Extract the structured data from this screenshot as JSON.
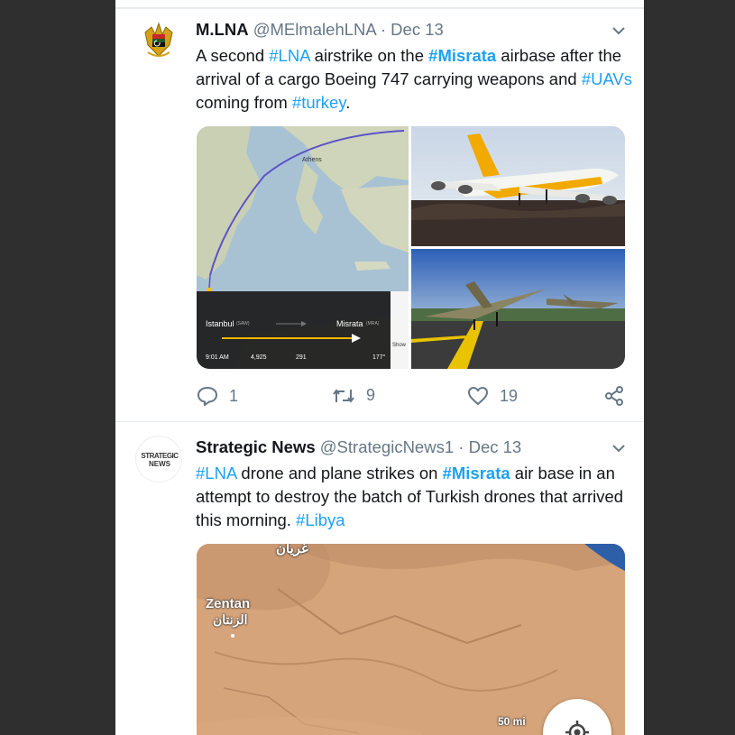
{
  "tweets": [
    {
      "name": "M.LNA",
      "handle": "@MElmalehLNA",
      "date": "Dec 13",
      "avatar_icon": "lna-emblem-icon",
      "text": [
        {
          "t": "A second ",
          "tag": false
        },
        {
          "t": "#LNA",
          "tag": true
        },
        {
          "t": " airstrike on the ",
          "tag": false
        },
        {
          "t": "#Misrata",
          "tag": true,
          "bold": true
        },
        {
          "t": " airbase after the arrival of a cargo Boeing 747 carrying weapons and ",
          "tag": false
        },
        {
          "t": "#UAVs",
          "tag": true
        },
        {
          "t": " coming from ",
          "tag": false
        },
        {
          "t": "#turkey",
          "tag": true
        },
        {
          "t": ".",
          "tag": false
        }
      ],
      "flight": {
        "from": "Istanbul",
        "from_code": "(SAW)",
        "to": "Misrata",
        "to_code": "(MRA)",
        "city_label": "Athens",
        "time": "9:01 AM",
        "alt": "4,925",
        "speed": "291",
        "heading": "177°",
        "side_label": "Show"
      },
      "replies": "1",
      "retweets": "9",
      "likes": "19"
    },
    {
      "name": "Strategic News",
      "handle": "@StrategicNews1",
      "date": "Dec 13",
      "avatar_text_1": "STRATEGIC",
      "avatar_text_2": "NEWS",
      "text": [
        {
          "t": "#LNA",
          "tag": true
        },
        {
          "t": " drone and plane strikes on ",
          "tag": false
        },
        {
          "t": "#Misrata",
          "tag": true,
          "bold": true
        },
        {
          "t": " air base in an attempt to destroy the batch of Turkish drones that arrived this morning.  ",
          "tag": false
        },
        {
          "t": "#Libya",
          "tag": true
        }
      ],
      "map": {
        "town_top_ar": "غريان",
        "town_en": "Zentan",
        "town_ar": "الزنتان",
        "scale": "50 mi"
      }
    }
  ],
  "colors": {
    "accent": "#1da1f2",
    "text": "#14171a",
    "muted": "#657786"
  }
}
